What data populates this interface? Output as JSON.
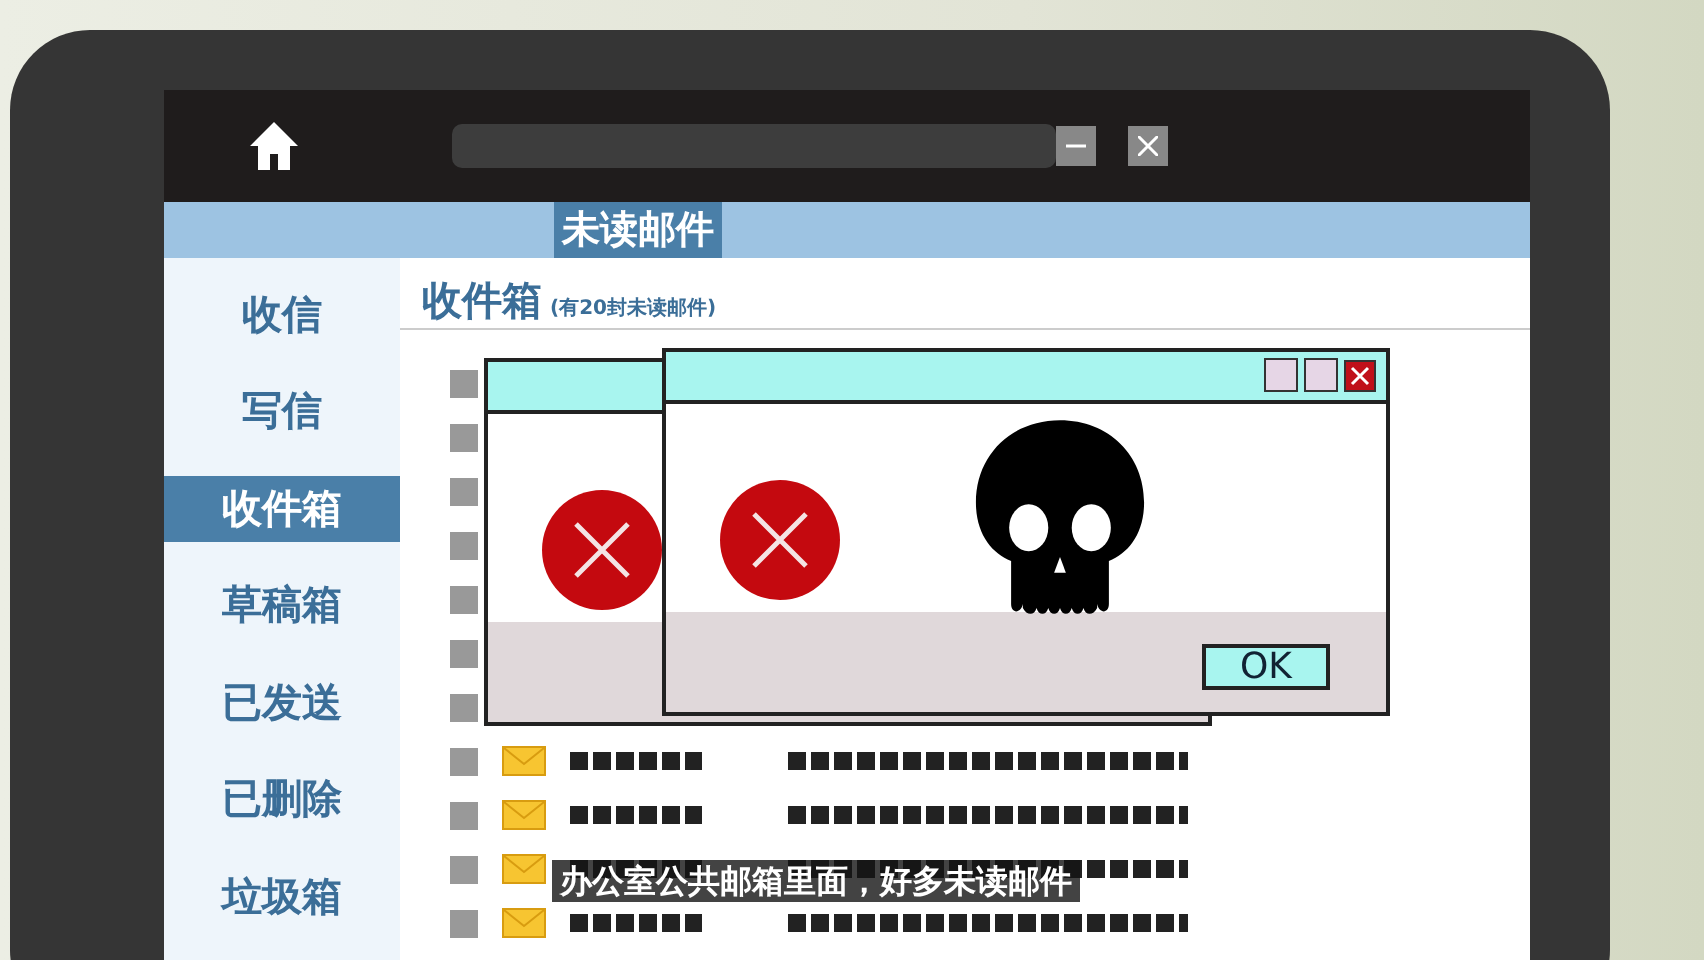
{
  "banner": {
    "label": "未读邮件"
  },
  "sidebar": {
    "items": [
      {
        "label": "收信",
        "selected": false
      },
      {
        "label": "写信",
        "selected": false
      },
      {
        "label": "收件箱",
        "selected": true
      },
      {
        "label": "草稿箱",
        "selected": false
      },
      {
        "label": "已发送",
        "selected": false
      },
      {
        "label": "已删除",
        "selected": false
      },
      {
        "label": "垃圾箱",
        "selected": false
      }
    ]
  },
  "inbox": {
    "title": "收件箱",
    "note": "(有20封未读邮件)",
    "rows": [
      {
        "checked": false
      },
      {
        "checked": false
      },
      {
        "checked": false
      },
      {
        "checked": false
      },
      {
        "checked": false
      },
      {
        "checked": false
      },
      {
        "checked": false
      },
      {
        "checked": false
      },
      {
        "checked": false
      },
      {
        "checked": false
      },
      {
        "checked": false
      }
    ]
  },
  "dialogs": [
    {
      "kind": "error"
    },
    {
      "kind": "skull",
      "button": "OK"
    }
  ],
  "subtitle": "办公室公共邮箱里面，好多未读邮件"
}
